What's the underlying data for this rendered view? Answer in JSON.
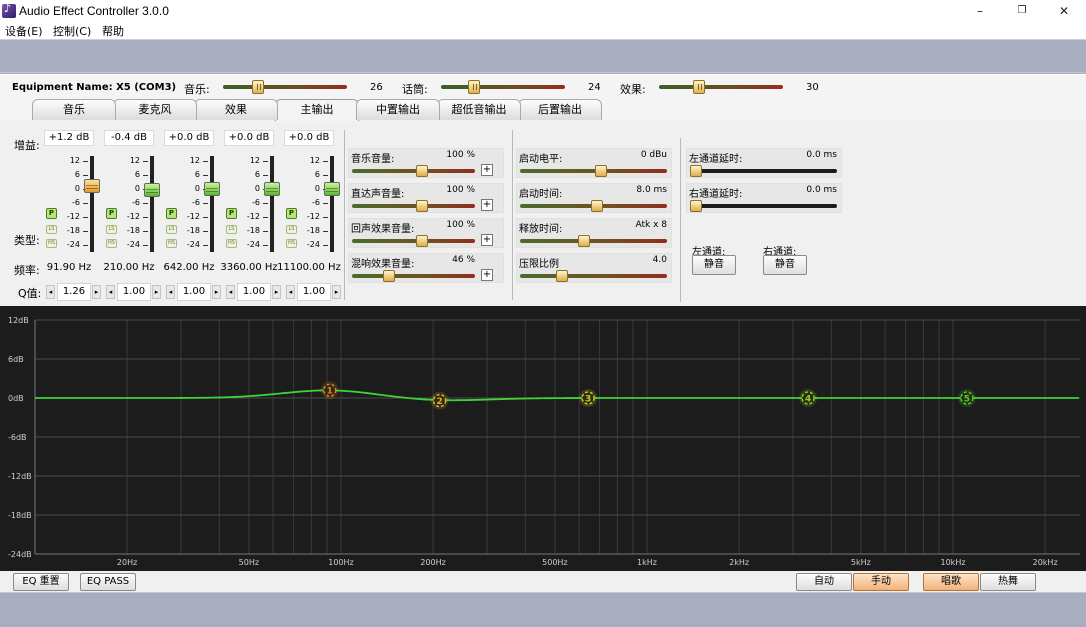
{
  "window": {
    "title": "Audio Effect Controller 3.0.0",
    "minimize": "–",
    "restore": "❐",
    "close": "✕"
  },
  "menu": {
    "items": [
      "设备(E)",
      "控制(C)",
      "帮助"
    ]
  },
  "device": {
    "name": "Equipment Name: X5 (COM3)",
    "music_label": "音乐:",
    "music_value": "26",
    "music_level": 26,
    "talk_label": "话筒:",
    "talk_value": "24",
    "talk_level": 24,
    "effect_label": "效果:",
    "effect_value": "30",
    "effect_level": 30
  },
  "tabs": [
    "音乐",
    "麦克风",
    "效果",
    "主输出",
    "中置输出",
    "超低音输出",
    "后置输出"
  ],
  "active_tab": 3,
  "eq": {
    "gain_label": "增益:",
    "type_label": "类型:",
    "freq_label": "频率:",
    "q_label": "Q值:",
    "bands": [
      {
        "gain": "+1.2 dB",
        "gain_db": 1.2,
        "freq": "91.90 Hz",
        "q": "1.26",
        "color": "orange"
      },
      {
        "gain": "-0.4 dB",
        "gain_db": -0.4,
        "freq": "210.00 Hz",
        "q": "1.00",
        "color": "green"
      },
      {
        "gain": "+0.0 dB",
        "gain_db": 0.0,
        "freq": "642.00 Hz",
        "q": "1.00",
        "color": "green"
      },
      {
        "gain": "+0.0 dB",
        "gain_db": 0.0,
        "freq": "3360.00 Hz",
        "q": "1.00",
        "color": "green"
      },
      {
        "gain": "+0.0 dB",
        "gain_db": 0.0,
        "freq": "11100.00 Hz",
        "q": "1.00",
        "color": "green"
      }
    ],
    "ticks": [
      "12",
      "6",
      "0",
      "-6",
      "-12",
      "-18",
      "-24"
    ],
    "type_p": "P",
    "type_ls": "LS",
    "type_hs": "HS",
    "spin_left": "◂",
    "spin_right": "▸"
  },
  "volumes": [
    {
      "label": "音乐音量:",
      "value": "100 %",
      "level": 100
    },
    {
      "label": "直达声音量:",
      "value": "100 %",
      "level": 100
    },
    {
      "label": "回声效果音量:",
      "value": "100 %",
      "level": 100
    },
    {
      "label": "混响效果音量:",
      "value": "46 %",
      "level": 46
    }
  ],
  "plus": "+",
  "compressor": [
    {
      "label": "启动电平:",
      "value": "0 dBu",
      "level": 0.55
    },
    {
      "label": "启动时间:",
      "value": "8.0 ms",
      "level": 0.52
    },
    {
      "label": "释放时间:",
      "value": "Atk x 8",
      "level": 0.42
    },
    {
      "label": "压限比例",
      "value": "4.0",
      "level": 0.26
    }
  ],
  "delays": [
    {
      "label": "左通道延时:",
      "value": "0.0 ms",
      "level": 0
    },
    {
      "label": "右通道延时:",
      "value": "0.0 ms",
      "level": 0
    }
  ],
  "mute": {
    "left_label": "左通道:",
    "right_label": "右通道:",
    "button": "静音"
  },
  "graph": {
    "y_ticks": [
      "12dB",
      "6dB",
      "0dB",
      "-6dB",
      "-12dB",
      "-18dB",
      "-24dB"
    ],
    "x_ticks": [
      "20Hz",
      "50Hz",
      "100Hz",
      "200Hz",
      "500Hz",
      "1kHz",
      "2kHz",
      "5kHz",
      "10kHz",
      "20kHz"
    ],
    "points": [
      {
        "label": "1",
        "freq": 91.9,
        "gain": 1.2,
        "color": "#e08020"
      },
      {
        "label": "2",
        "freq": 210,
        "gain": -0.4,
        "color": "#e0b020"
      },
      {
        "label": "3",
        "freq": 642,
        "gain": 0.0,
        "color": "#c8d020"
      },
      {
        "label": "4",
        "freq": 3360,
        "gain": 0.0,
        "color": "#90d020"
      },
      {
        "label": "5",
        "freq": 11100,
        "gain": 0.0,
        "color": "#50d020"
      }
    ]
  },
  "bottom": {
    "eq_reset": "EQ 重置",
    "eq_pass": "EQ PASS",
    "auto": "自动",
    "manual": "手动",
    "sing": "唱歌",
    "dance": "热舞"
  }
}
